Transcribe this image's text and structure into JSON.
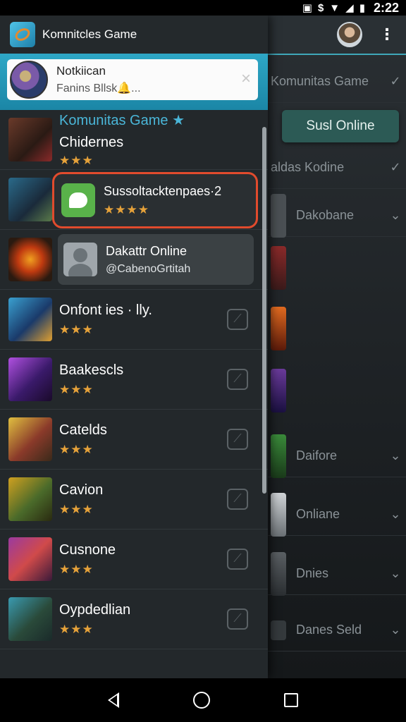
{
  "status_bar": {
    "time": "2:22",
    "icons": [
      "notification-icon",
      "dollar-icon",
      "wifi-icon",
      "signal-icon",
      "battery-icon"
    ]
  },
  "drawer": {
    "title": "Komnitcles Game",
    "notification": {
      "title": "Notkiican",
      "subtitle": "Fanins Bllsk🔔...",
      "close": "×"
    },
    "items": [
      {
        "title": "Komunitas Game ★",
        "subtitle": "Chidernes",
        "stars": "★★★"
      },
      {
        "card_title": "Sussoltacktenpaes·2",
        "stars": "★★★★"
      },
      {
        "card_title": "Dakattr Online",
        "card_subtitle": "@CabenoGrtitah"
      },
      {
        "title": "Onfont ies · lly.",
        "stars": "★★★"
      },
      {
        "title": "Baakescls",
        "stars": "★★★"
      },
      {
        "title": "Catelds",
        "stars": "★★★"
      },
      {
        "title": "Cavion",
        "stars": "★★★"
      },
      {
        "title": "Cusnone",
        "stars": "★★★"
      },
      {
        "title": "Oypdedlian",
        "stars": "★★★"
      }
    ]
  },
  "background": {
    "online_button": "Susl Online",
    "rows": [
      {
        "label": "Komunitas Game",
        "control": "✓"
      },
      {
        "label": "aldas Kodine",
        "control": "✓"
      },
      {
        "label": "Dakobane",
        "control": "⌄"
      },
      {
        "label": "Daifore",
        "control": "⌄"
      },
      {
        "label": "Onliane",
        "control": "⌄"
      },
      {
        "label": "Dnies",
        "control": "⌄"
      },
      {
        "label": "Danes Seld",
        "control": "⌄"
      }
    ]
  },
  "colors": {
    "accent": "#4ab6d8",
    "highlight_border": "#e14b2d",
    "star": "#e6a23a",
    "online_button": "#2c5a55"
  }
}
